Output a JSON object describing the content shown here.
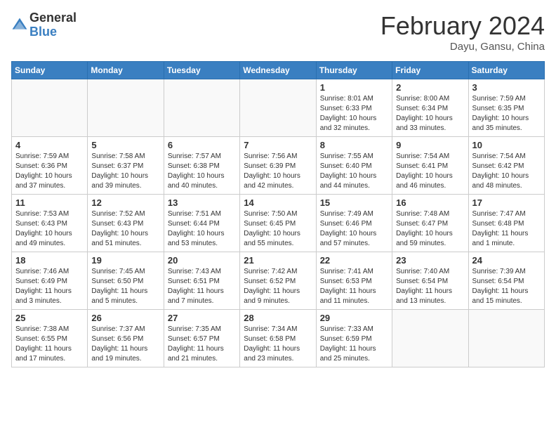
{
  "header": {
    "logo_general": "General",
    "logo_blue": "Blue",
    "month_title": "February 2024",
    "subtitle": "Dayu, Gansu, China"
  },
  "days_of_week": [
    "Sunday",
    "Monday",
    "Tuesday",
    "Wednesday",
    "Thursday",
    "Friday",
    "Saturday"
  ],
  "weeks": [
    [
      {
        "num": "",
        "info": ""
      },
      {
        "num": "",
        "info": ""
      },
      {
        "num": "",
        "info": ""
      },
      {
        "num": "",
        "info": ""
      },
      {
        "num": "1",
        "info": "Sunrise: 8:01 AM\nSunset: 6:33 PM\nDaylight: 10 hours\nand 32 minutes."
      },
      {
        "num": "2",
        "info": "Sunrise: 8:00 AM\nSunset: 6:34 PM\nDaylight: 10 hours\nand 33 minutes."
      },
      {
        "num": "3",
        "info": "Sunrise: 7:59 AM\nSunset: 6:35 PM\nDaylight: 10 hours\nand 35 minutes."
      }
    ],
    [
      {
        "num": "4",
        "info": "Sunrise: 7:59 AM\nSunset: 6:36 PM\nDaylight: 10 hours\nand 37 minutes."
      },
      {
        "num": "5",
        "info": "Sunrise: 7:58 AM\nSunset: 6:37 PM\nDaylight: 10 hours\nand 39 minutes."
      },
      {
        "num": "6",
        "info": "Sunrise: 7:57 AM\nSunset: 6:38 PM\nDaylight: 10 hours\nand 40 minutes."
      },
      {
        "num": "7",
        "info": "Sunrise: 7:56 AM\nSunset: 6:39 PM\nDaylight: 10 hours\nand 42 minutes."
      },
      {
        "num": "8",
        "info": "Sunrise: 7:55 AM\nSunset: 6:40 PM\nDaylight: 10 hours\nand 44 minutes."
      },
      {
        "num": "9",
        "info": "Sunrise: 7:54 AM\nSunset: 6:41 PM\nDaylight: 10 hours\nand 46 minutes."
      },
      {
        "num": "10",
        "info": "Sunrise: 7:54 AM\nSunset: 6:42 PM\nDaylight: 10 hours\nand 48 minutes."
      }
    ],
    [
      {
        "num": "11",
        "info": "Sunrise: 7:53 AM\nSunset: 6:43 PM\nDaylight: 10 hours\nand 49 minutes."
      },
      {
        "num": "12",
        "info": "Sunrise: 7:52 AM\nSunset: 6:43 PM\nDaylight: 10 hours\nand 51 minutes."
      },
      {
        "num": "13",
        "info": "Sunrise: 7:51 AM\nSunset: 6:44 PM\nDaylight: 10 hours\nand 53 minutes."
      },
      {
        "num": "14",
        "info": "Sunrise: 7:50 AM\nSunset: 6:45 PM\nDaylight: 10 hours\nand 55 minutes."
      },
      {
        "num": "15",
        "info": "Sunrise: 7:49 AM\nSunset: 6:46 PM\nDaylight: 10 hours\nand 57 minutes."
      },
      {
        "num": "16",
        "info": "Sunrise: 7:48 AM\nSunset: 6:47 PM\nDaylight: 10 hours\nand 59 minutes."
      },
      {
        "num": "17",
        "info": "Sunrise: 7:47 AM\nSunset: 6:48 PM\nDaylight: 11 hours\nand 1 minute."
      }
    ],
    [
      {
        "num": "18",
        "info": "Sunrise: 7:46 AM\nSunset: 6:49 PM\nDaylight: 11 hours\nand 3 minutes."
      },
      {
        "num": "19",
        "info": "Sunrise: 7:45 AM\nSunset: 6:50 PM\nDaylight: 11 hours\nand 5 minutes."
      },
      {
        "num": "20",
        "info": "Sunrise: 7:43 AM\nSunset: 6:51 PM\nDaylight: 11 hours\nand 7 minutes."
      },
      {
        "num": "21",
        "info": "Sunrise: 7:42 AM\nSunset: 6:52 PM\nDaylight: 11 hours\nand 9 minutes."
      },
      {
        "num": "22",
        "info": "Sunrise: 7:41 AM\nSunset: 6:53 PM\nDaylight: 11 hours\nand 11 minutes."
      },
      {
        "num": "23",
        "info": "Sunrise: 7:40 AM\nSunset: 6:54 PM\nDaylight: 11 hours\nand 13 minutes."
      },
      {
        "num": "24",
        "info": "Sunrise: 7:39 AM\nSunset: 6:54 PM\nDaylight: 11 hours\nand 15 minutes."
      }
    ],
    [
      {
        "num": "25",
        "info": "Sunrise: 7:38 AM\nSunset: 6:55 PM\nDaylight: 11 hours\nand 17 minutes."
      },
      {
        "num": "26",
        "info": "Sunrise: 7:37 AM\nSunset: 6:56 PM\nDaylight: 11 hours\nand 19 minutes."
      },
      {
        "num": "27",
        "info": "Sunrise: 7:35 AM\nSunset: 6:57 PM\nDaylight: 11 hours\nand 21 minutes."
      },
      {
        "num": "28",
        "info": "Sunrise: 7:34 AM\nSunset: 6:58 PM\nDaylight: 11 hours\nand 23 minutes."
      },
      {
        "num": "29",
        "info": "Sunrise: 7:33 AM\nSunset: 6:59 PM\nDaylight: 11 hours\nand 25 minutes."
      },
      {
        "num": "",
        "info": ""
      },
      {
        "num": "",
        "info": ""
      }
    ]
  ]
}
